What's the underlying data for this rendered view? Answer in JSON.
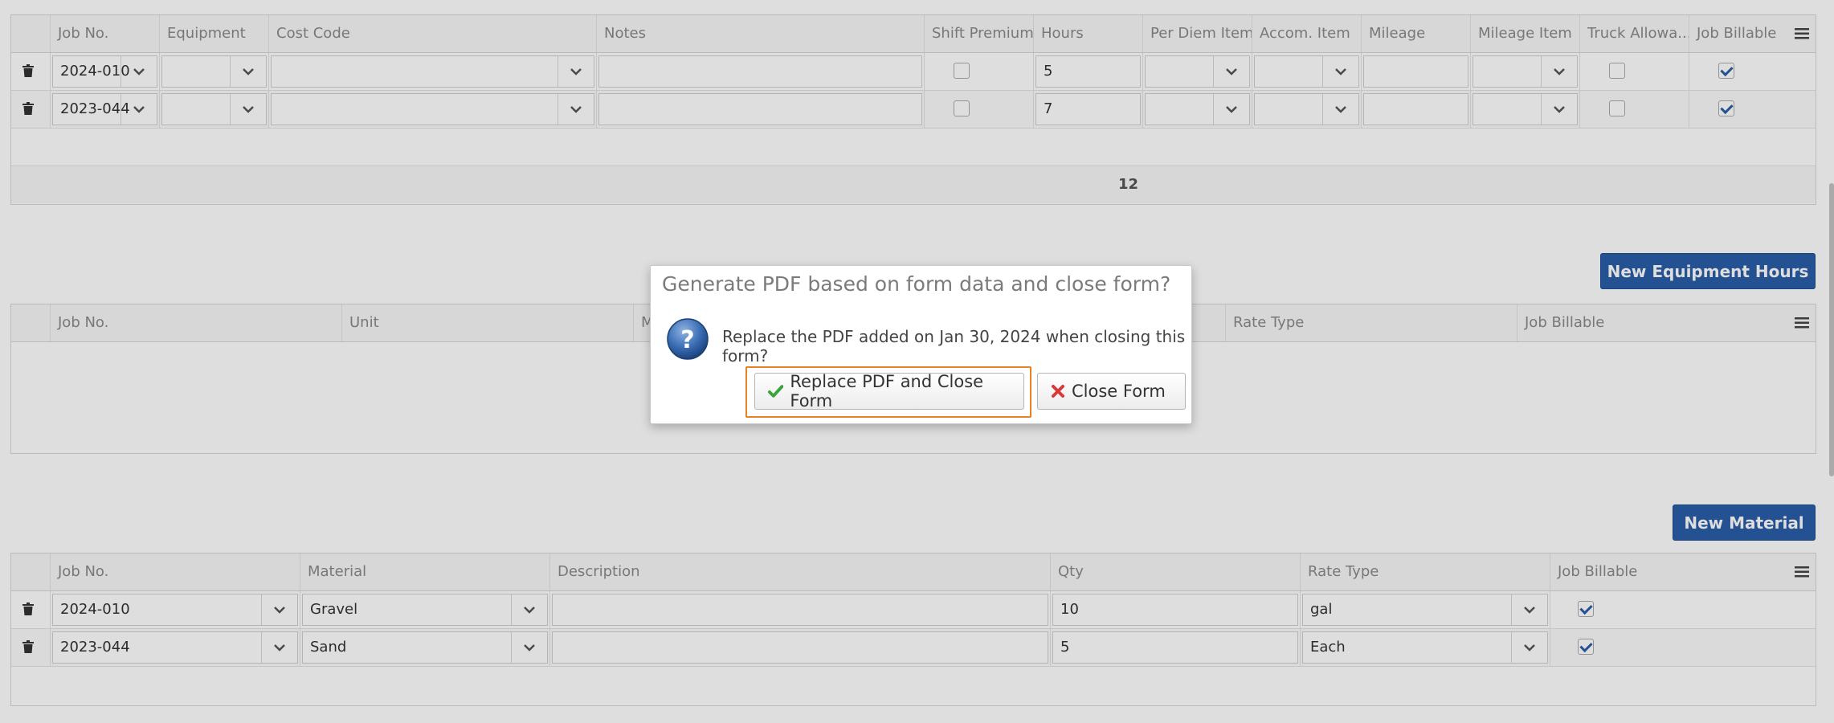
{
  "labor_grid": {
    "columns": [
      "Job No.",
      "Equipment",
      "Cost Code",
      "Notes",
      "Shift Premium",
      "Hours",
      "Per Diem Item",
      "Accom. Item",
      "Mileage",
      "Mileage Item",
      "Truck Allowa...",
      "Job Billable"
    ],
    "rows": [
      {
        "job_no": "2024-010",
        "equipment": "",
        "cost_code": "",
        "notes": "",
        "shift_premium": false,
        "hours": "5",
        "per_diem_item": "",
        "accom_item": "",
        "mileage": "",
        "mileage_item": "",
        "truck_allowance": false,
        "job_billable": true
      },
      {
        "job_no": "2023-044",
        "equipment": "",
        "cost_code": "",
        "notes": "",
        "shift_premium": false,
        "hours": "7",
        "per_diem_item": "",
        "accom_item": "",
        "mileage": "",
        "mileage_item": "",
        "truck_allowance": false,
        "job_billable": true
      }
    ],
    "hours_total": "12"
  },
  "equipment_section": {
    "new_button_label": "New Equipment Hours",
    "columns": [
      "Job No.",
      "Unit",
      "M",
      "Rate Type",
      "Job Billable"
    ]
  },
  "material_section": {
    "new_button_label": "New Material",
    "columns": [
      "Job No.",
      "Material",
      "Description",
      "Qty",
      "Rate Type",
      "Job Billable"
    ],
    "rows": [
      {
        "job_no": "2024-010",
        "material": "Gravel",
        "description": "",
        "qty": "10",
        "rate_type": "gal",
        "job_billable": true
      },
      {
        "job_no": "2023-044",
        "material": "Sand",
        "description": "",
        "qty": "5",
        "rate_type": "Each",
        "job_billable": true
      }
    ]
  },
  "dialog": {
    "title": "Generate PDF based on form data and close form?",
    "message": "Replace the PDF added on Jan 30, 2024 when closing this form?",
    "primary_label": "Replace PDF and Close Form",
    "secondary_label": "Close Form",
    "icon": "question-icon"
  },
  "colors": {
    "accent": "#2a5ea8",
    "focus": "#e8821e",
    "success": "#3aa33a",
    "danger": "#d83a3a"
  }
}
